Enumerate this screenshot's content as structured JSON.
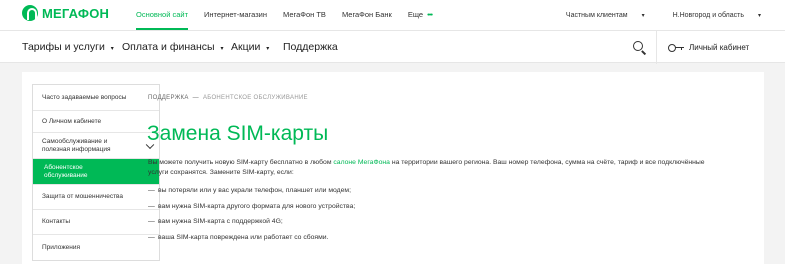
{
  "logo": {
    "text": "МЕГАФОН"
  },
  "topnav": {
    "items": [
      "Основной сайт",
      "Интернет-магазин",
      "МегаФон ТВ",
      "МегаФон Банк",
      "Еще"
    ],
    "more_dots": "•••",
    "clients": "Частным клиентам",
    "region": "Н.Новгород и область"
  },
  "mainnav": {
    "items": [
      "Тарифы и услуги",
      "Оплата и финансы",
      "Акции",
      "Поддержка"
    ],
    "cabinet": "Личный кабинет"
  },
  "sidebar": {
    "items": [
      "Часто задаваемые вопросы",
      "О Личном кабинете",
      "Самообслуживание и полезная информация",
      "Абонентское обслуживание",
      "Защита от мошенничества",
      "Контакты",
      "Приложения"
    ]
  },
  "breadcrumb": {
    "root": "ПОДДЕРЖКА",
    "sep": "—",
    "current": "АБОНЕНТСКОЕ ОБСЛУЖИВАНИЕ"
  },
  "page": {
    "title": "Замена SIM-карты",
    "intro_before": "Вы можете получить новую SIM-карту бесплатно в любом ",
    "intro_link": "салоне МегаФона",
    "intro_after": " на территории вашего региона. Ваш номер телефона, сумма на счёте, тариф и все подключённые услуги сохранятся. Замените SIM-карту, если:",
    "bullets": [
      "вы потеряли или у вас украли телефон, планшет или модем;",
      "вам нужна SIM-карта другого формата для нового устройства;",
      "вам нужна SIM-карта с поддержкой 4G;",
      "ваша SIM-карта повреждена или работает со сбоями."
    ],
    "bullet_mark": "—"
  },
  "colors": {
    "brand": "#00b956"
  }
}
